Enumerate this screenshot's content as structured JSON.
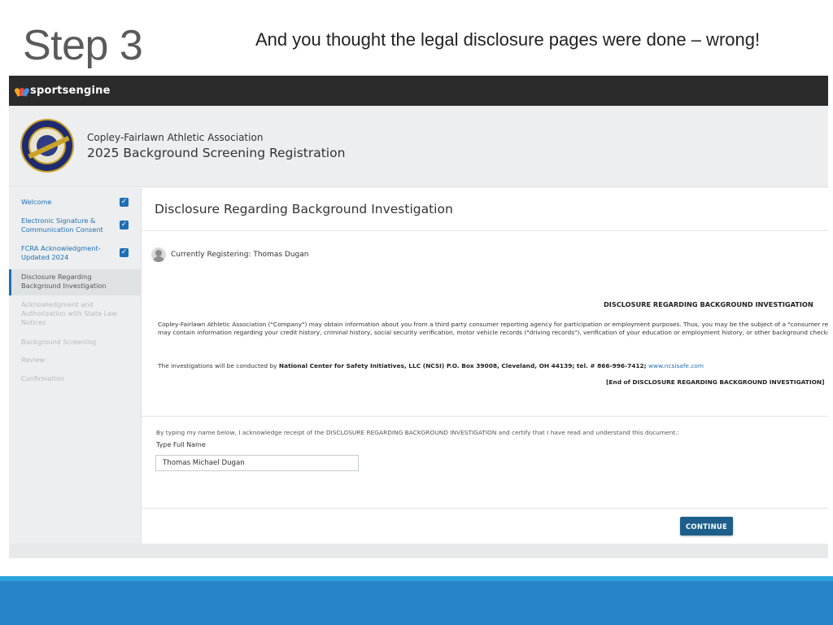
{
  "slide": {
    "title": "Step 3",
    "subtitle": "And you thought the legal disclosure pages were done – wrong!"
  },
  "topbar": {
    "brand": "sportsengine",
    "brand_icon": "nbc-peacock-icon"
  },
  "header": {
    "org_name": "Copley-Fairlawn Athletic Association",
    "registration_title": "2025 Background Screening Registration"
  },
  "sidebar": {
    "items": [
      {
        "label": "Welcome",
        "state": "done"
      },
      {
        "label": "Electronic Signature & Communication Consent",
        "state": "done"
      },
      {
        "label": "FCRA Acknowledgment-Updated 2024",
        "state": "done"
      },
      {
        "label": "Disclosure Regarding Background Investigation",
        "state": "active"
      },
      {
        "label": "Acknowledgment and Authorization with State Law Notices",
        "state": "todo"
      },
      {
        "label": "Background Screening",
        "state": "todo"
      },
      {
        "label": "Review",
        "state": "todo"
      },
      {
        "label": "Confirmation",
        "state": "todo"
      }
    ]
  },
  "content": {
    "title": "Disclosure Regarding Background Investigation",
    "currently_registering": "Currently Registering: Thomas Dugan",
    "disclosure_heading": "DISCLOSURE REGARDING BACKGROUND INVESTIGATION",
    "paragraph_line1": "Copley-Fairlawn Athletic Association (\"Company\") may obtain information about you from a third party consumer reporting agency for participation or employment purposes. Thus, you may be the subject of a \"consumer re",
    "paragraph_line2": "may contain information regarding your credit history, criminal history, social security verification, motor vehicle records (\"driving records\"), verification of your education or employment history, or other background checks.",
    "conducted_prefix": "The investigations will be conducted by",
    "conducted_bold": "National Center for Safety Initiatives, LLC (NCSI) P.O. Box 39008, Cleveland, OH 44139; tel. # 866-996-7412;",
    "conducted_link": "www.ncsisafe.com",
    "disclosure_end": "[End of DISCLOSURE REGARDING BACKGROUND INVESTIGATION]",
    "acknowledge_text": "By typing my name below, I acknowledge receipt of the DISCLOSURE REGARDING BACKGROUND INVESTIGATION and certify that I have read and understand this document.:",
    "field_label": "Type Full Name",
    "field_value": "Thomas Michael Dugan",
    "continue_label": "CONTINUE"
  },
  "colors": {
    "accent_blue": "#1f6fb5",
    "button_blue": "#1d5f8a",
    "topbar_dark": "#2b2b2b",
    "footer_blue": "#2884c8"
  }
}
